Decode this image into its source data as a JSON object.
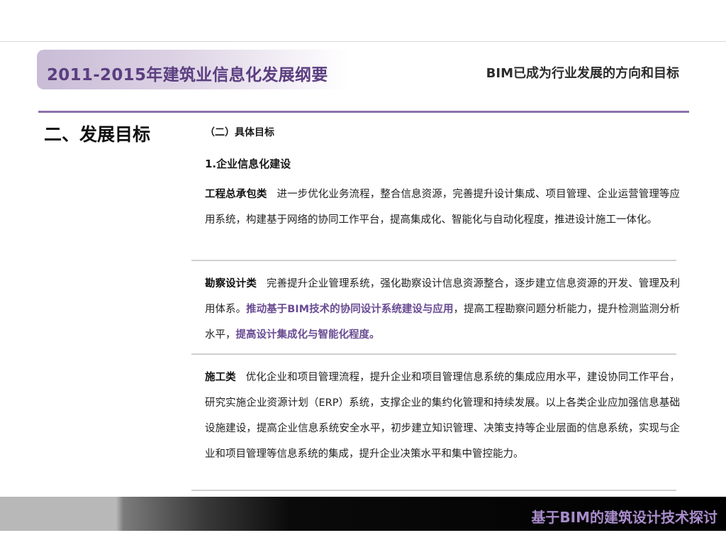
{
  "header": {
    "title": "2011-2015年建筑业信息化发展纲要",
    "subtitle": "BIM已成为行业发展的方向和目标"
  },
  "section": {
    "heading": "二、发展目标",
    "sub_heading": "（二）具体目标",
    "item_heading": "1.企业信息化建设"
  },
  "paragraphs": [
    {
      "lead": "工程总承包类",
      "text": "进一步优化业务流程，整合信息资源，完善提升设计集成、项目管理、企业运营管理等应用系统，构建基于网络的协同工作平台，提高集成化、智能化与自动化程度，推进设计施工一体化。"
    },
    {
      "lead": "勘察设计类",
      "text_a": "完善提升企业管理系统，强化勘察设计信息资源整合，逐步建立信息资源的开发、管理及利用体系。",
      "highlight_a": "推动基于BIM技术的协同设计系统建设与应用",
      "text_b": "，提高工程勘察问题分析能力，提升检测监测分析水平，",
      "highlight_b": "提高设计集成化与智能化程度。"
    },
    {
      "lead": "施工类",
      "text": "优化企业和项目管理流程，提升企业和项目管理信息系统的集成应用水平，建设协同工作平台，研究实施企业资源计划（ERP）系统，支撑企业的集约化管理和持续发展。以上各类企业应加强信息基础设施建设，提高企业信息系统安全水平，初步建立知识管理、决策支持等企业层面的信息系统，实现与企业和项目管理等信息系统的集成，提升企业决策水平和集中管控能力。"
    }
  ],
  "footer": {
    "text": "基于BIM的建筑设计技术探讨"
  },
  "colors": {
    "accent": "#6a4c93",
    "rule": "#8d72ab",
    "footer_text": "#a98ccc"
  }
}
